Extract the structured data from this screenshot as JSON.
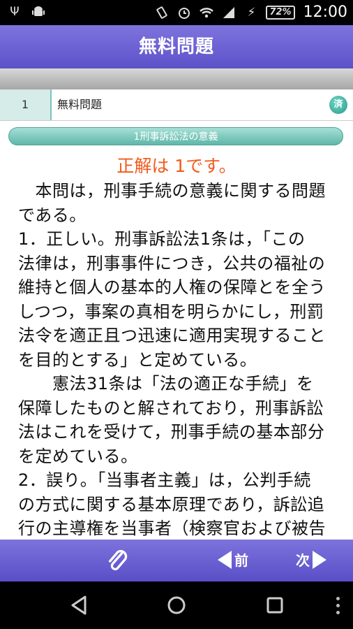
{
  "status_bar": {
    "battery": "72%",
    "time": "12:00",
    "icons": [
      "usb-icon",
      "android-icon",
      "vibrate-icon",
      "alarm-icon",
      "wifi-icon",
      "signal-icon",
      "charging-icon"
    ]
  },
  "header": {
    "title": "無料問題"
  },
  "question": {
    "number": "1",
    "title": "無料問題",
    "badge": "済"
  },
  "topic": "1刑事訴訟法の意義",
  "answer_heading": "正解は 1です。",
  "body_lines": [
    "　本問は，刑事手続の意義に関する問題",
    "である。",
    "1．正しい。刑事訴訟法1条は，「この",
    "法律は，刑事事件につき，公共の福祉の",
    "維持と個人の基本的人権の保障とを全う",
    "しつつ，事案の真相を明らかにし，刑罰",
    "法令を適正且つ迅速に適用実現すること",
    "を目的とする」と定めている。",
    "　　憲法31条は「法の適正な手続」を",
    "保障したものと解されており，刑事訴訟",
    "法はこれを受けて，刑事手続の基本部分",
    "を定めている。",
    "2．誤り。「当事者主義」は，公判手続",
    "の方式に関する基本原理であり，訴訟追",
    "行の主導権を当事者（検察官および被告"
  ],
  "bottom_bar": {
    "prev_label": "前",
    "next_label": "次"
  },
  "colors": {
    "header": "#6b61d3",
    "accent_teal": "#5fb7a9",
    "answer": "#f25a1a"
  }
}
